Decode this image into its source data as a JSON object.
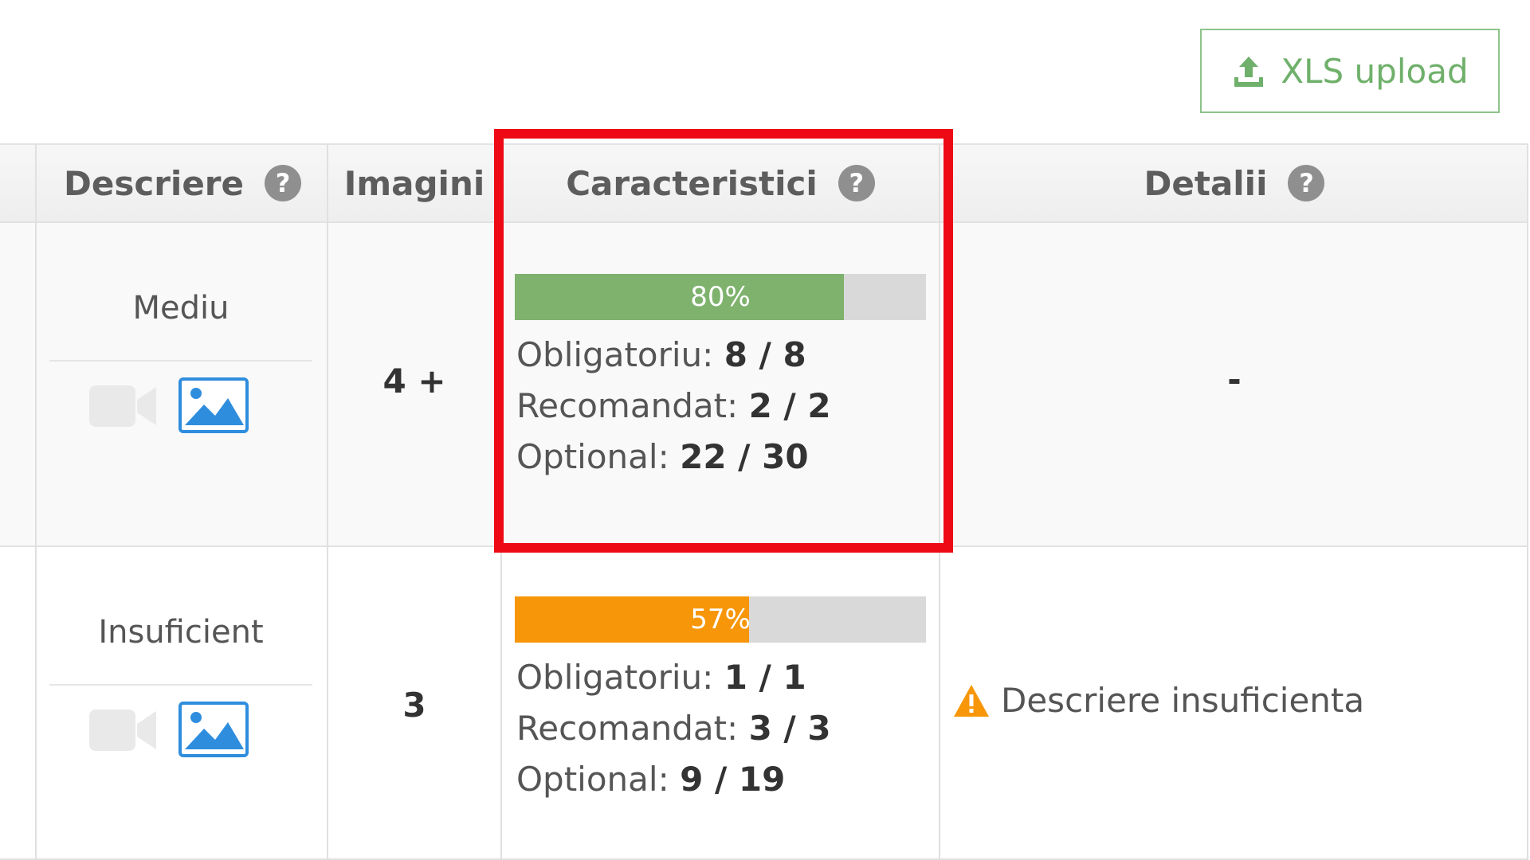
{
  "toolbar": {
    "upload_label": "XLS upload"
  },
  "table": {
    "headers": {
      "descriere": "Descriere",
      "imagini": "Imagini",
      "caracteristici": "Caracteristici",
      "detalii": "Detalii"
    },
    "help_glyph": "?",
    "rows": [
      {
        "descriere": "Mediu",
        "imagini": "4 +",
        "progress_label": "80%",
        "progress_value": 0.8,
        "progress_color": "#7eb26d",
        "obligatoriu_label": "Obligatoriu:",
        "obligatoriu": "8 / 8",
        "recomandat_label": "Recomandat:",
        "recomandat": "2 / 2",
        "optional_label": "Optional:",
        "optional": "22 / 30",
        "detalii": "-"
      },
      {
        "descriere": "Insuficient",
        "imagini": "3",
        "progress_label": "57%",
        "progress_value": 0.57,
        "progress_color": "#f79608",
        "obligatoriu_label": "Obligatoriu:",
        "obligatoriu": "1 / 1",
        "recomandat_label": "Recomandat:",
        "recomandat": "3 / 3",
        "optional_label": "Optional:",
        "optional": "9 / 19",
        "detalii": "Descriere insuficienta"
      }
    ]
  },
  "colors": {
    "accent_green": "#6fb06b",
    "highlight_red": "#ee0a14",
    "image_icon_blue": "#2f8ddd",
    "warning_orange": "#f79608"
  },
  "icons": {
    "upload": "upload-icon",
    "help": "help-icon",
    "video": "video-icon",
    "image": "image-icon",
    "warning": "warning-icon"
  }
}
